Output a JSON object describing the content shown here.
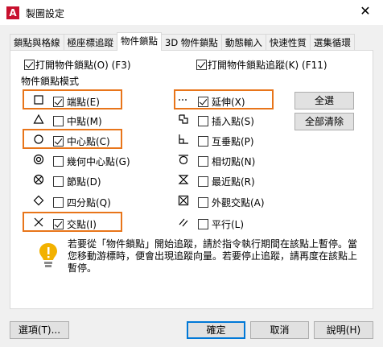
{
  "window": {
    "title": "製圖設定",
    "app_icon_letter": "A",
    "close_glyph": "✕"
  },
  "tabs": [
    {
      "label": "鎖點與格線",
      "active": false
    },
    {
      "label": "極座標追蹤",
      "active": false
    },
    {
      "label": "物件鎖點",
      "active": true
    },
    {
      "label": "3D 物件鎖點",
      "active": false
    },
    {
      "label": "動態輸入",
      "active": false
    },
    {
      "label": "快速性質",
      "active": false
    },
    {
      "label": "選集循環",
      "active": false
    }
  ],
  "top_options": {
    "osnap_on": {
      "label": "打開物件鎖點(O) (F3)",
      "checked": true
    },
    "otrack_on": {
      "label": "打開物件鎖點追蹤(K) (F11)",
      "checked": true
    }
  },
  "group_title": "物件鎖點模式",
  "modes_left": [
    {
      "label": "端點(E)",
      "checked": true,
      "icon": "endpoint-square-icon",
      "highlight": true
    },
    {
      "label": "中點(M)",
      "checked": false,
      "icon": "midpoint-triangle-icon",
      "highlight": false
    },
    {
      "label": "中心點(C)",
      "checked": true,
      "icon": "center-circle-icon",
      "highlight": true
    },
    {
      "label": "幾何中心點(G)",
      "checked": false,
      "icon": "geometric-center-icon",
      "highlight": false
    },
    {
      "label": "節點(D)",
      "checked": false,
      "icon": "node-icon",
      "highlight": false
    },
    {
      "label": "四分點(Q)",
      "checked": false,
      "icon": "quadrant-diamond-icon",
      "highlight": false
    },
    {
      "label": "交點(I)",
      "checked": true,
      "icon": "intersection-x-icon",
      "highlight": true
    }
  ],
  "modes_right": [
    {
      "label": "延伸(X)",
      "checked": true,
      "icon": "extension-dash-icon",
      "highlight": true
    },
    {
      "label": "插入點(S)",
      "checked": false,
      "icon": "insertion-icon",
      "highlight": false
    },
    {
      "label": "互垂點(P)",
      "checked": false,
      "icon": "perpendicular-icon",
      "highlight": false
    },
    {
      "label": "相切點(N)",
      "checked": false,
      "icon": "tangent-icon",
      "highlight": false
    },
    {
      "label": "最近點(R)",
      "checked": false,
      "icon": "nearest-hourglass-icon",
      "highlight": false
    },
    {
      "label": "外觀交點(A)",
      "checked": false,
      "icon": "apparent-intersection-icon",
      "highlight": false
    },
    {
      "label": "平行(L)",
      "checked": false,
      "icon": "parallel-icon",
      "highlight": false
    }
  ],
  "side_buttons": {
    "select_all": "全選",
    "clear_all": "全部清除"
  },
  "info_text": "若要從「物件鎖點」開始追蹤，請於指令執行期間在該點上暫停。當您移動游標時，便會出現追蹤向量。若要停止追蹤，請再度在該點上暫停。",
  "footer": {
    "options": "選項(T)...",
    "ok": "確定",
    "cancel": "取消",
    "help": "說明(H)"
  },
  "colors": {
    "highlight": "#e8751a",
    "bulb": "#f2b100",
    "primary_border": "#0078d7"
  }
}
